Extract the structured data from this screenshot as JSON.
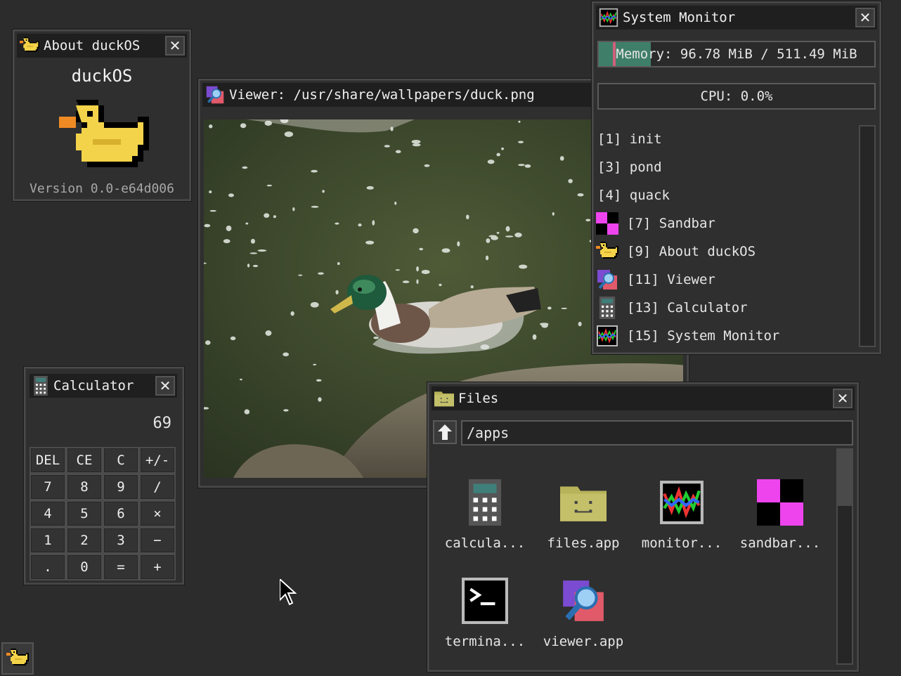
{
  "about": {
    "title": "About duckOS",
    "app_name": "duckOS",
    "version": "Version 0.0-e64d006",
    "close_icon": "close-icon"
  },
  "viewer": {
    "title": "Viewer: /usr/share/wallpapers/duck.png"
  },
  "sysmon": {
    "title": "System Monitor",
    "memory_label": "Memory: 96.78 MiB / 511.49 MiB",
    "memory_fraction": 0.189,
    "cpu_label": "CPU: 0.0%",
    "cpu_fraction": 0.0,
    "processes": [
      {
        "label": "[1] init",
        "icon": "none"
      },
      {
        "label": "[3] pond",
        "icon": "none"
      },
      {
        "label": "[4] quack",
        "icon": "none"
      },
      {
        "label": "[7] Sandbar",
        "icon": "sandbar-icon"
      },
      {
        "label": "[9] About duckOS",
        "icon": "duck-icon"
      },
      {
        "label": "[11] Viewer",
        "icon": "viewer-icon"
      },
      {
        "label": "[13] Calculator",
        "icon": "calculator-icon"
      },
      {
        "label": "[15] System Monitor",
        "icon": "monitor-icon"
      }
    ],
    "colors": {
      "memory_fill": "#3f7f6a",
      "memory_mark": "#d0607a"
    }
  },
  "calculator": {
    "title": "Calculator",
    "display": "69",
    "keys": [
      "DEL",
      "CE",
      "C",
      "+/-",
      "7",
      "8",
      "9",
      "/",
      "4",
      "5",
      "6",
      "×",
      "1",
      "2",
      "3",
      "−",
      ".",
      "0",
      "=",
      "+"
    ]
  },
  "files": {
    "title": "Files",
    "path": "/apps",
    "items": [
      {
        "label": "calcula...",
        "icon": "calculator-icon"
      },
      {
        "label": "files.app",
        "icon": "folder-icon"
      },
      {
        "label": "monitor...",
        "icon": "monitor-icon"
      },
      {
        "label": "sandbar...",
        "icon": "sandbar-icon"
      },
      {
        "label": "termina...",
        "icon": "terminal-icon"
      },
      {
        "label": "viewer.app",
        "icon": "viewer-icon"
      }
    ]
  },
  "taskbar": {
    "icon": "duck-icon"
  }
}
